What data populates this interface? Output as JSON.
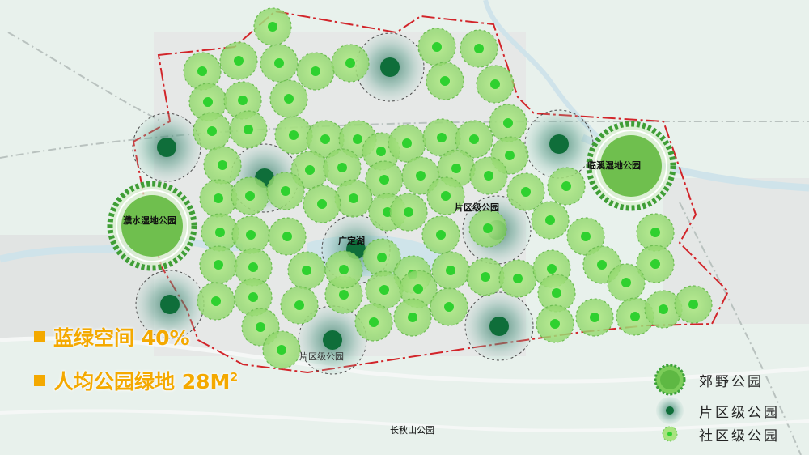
{
  "stats": {
    "blue_green_space": "蓝绿空间 40%",
    "park_per_capita_prefix": "人均公园绿地 28M",
    "park_per_capita_sup": "2"
  },
  "labels": {
    "park_west": "濮水湿地公园",
    "park_east": "临溪湿地公园",
    "lake": "广定湖",
    "district_park_1": "片区级公园",
    "district_park_2": "片区级公园",
    "mountain_park": "长秋山公园"
  },
  "legend": {
    "country_park": "郊野公园",
    "district_park": "片区级公园",
    "community_park": "社区级公园"
  },
  "colors": {
    "background": "#e9f2ee",
    "boundary": "#d2252a",
    "community_fill": "#9bdc73",
    "community_dot": "#2fd12f",
    "district_core": "#0f6e3a",
    "country_core": "#6fbf4e",
    "accent_text": "#f4a900"
  }
}
